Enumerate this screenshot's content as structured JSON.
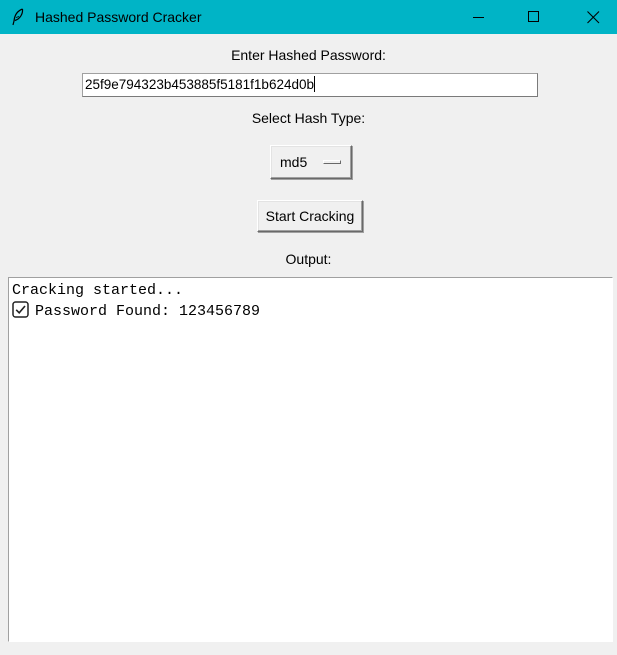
{
  "window": {
    "title": "Hashed Password Cracker",
    "titlebar_color": "#00b4c6",
    "icon": "feather-icon"
  },
  "form": {
    "hash_label": "Enter Hashed Password:",
    "hash_value": "25f9e794323b453885f5181f1b624d0b",
    "type_label": "Select Hash Type:",
    "hash_type_selected": "md5",
    "start_button_label": "Start Cracking",
    "output_label": "Output:"
  },
  "output": {
    "lines": [
      {
        "text": "Cracking started...",
        "icon": null
      },
      {
        "text": "Password Found: 123456789",
        "icon": "checkbox-checked-icon"
      }
    ]
  }
}
